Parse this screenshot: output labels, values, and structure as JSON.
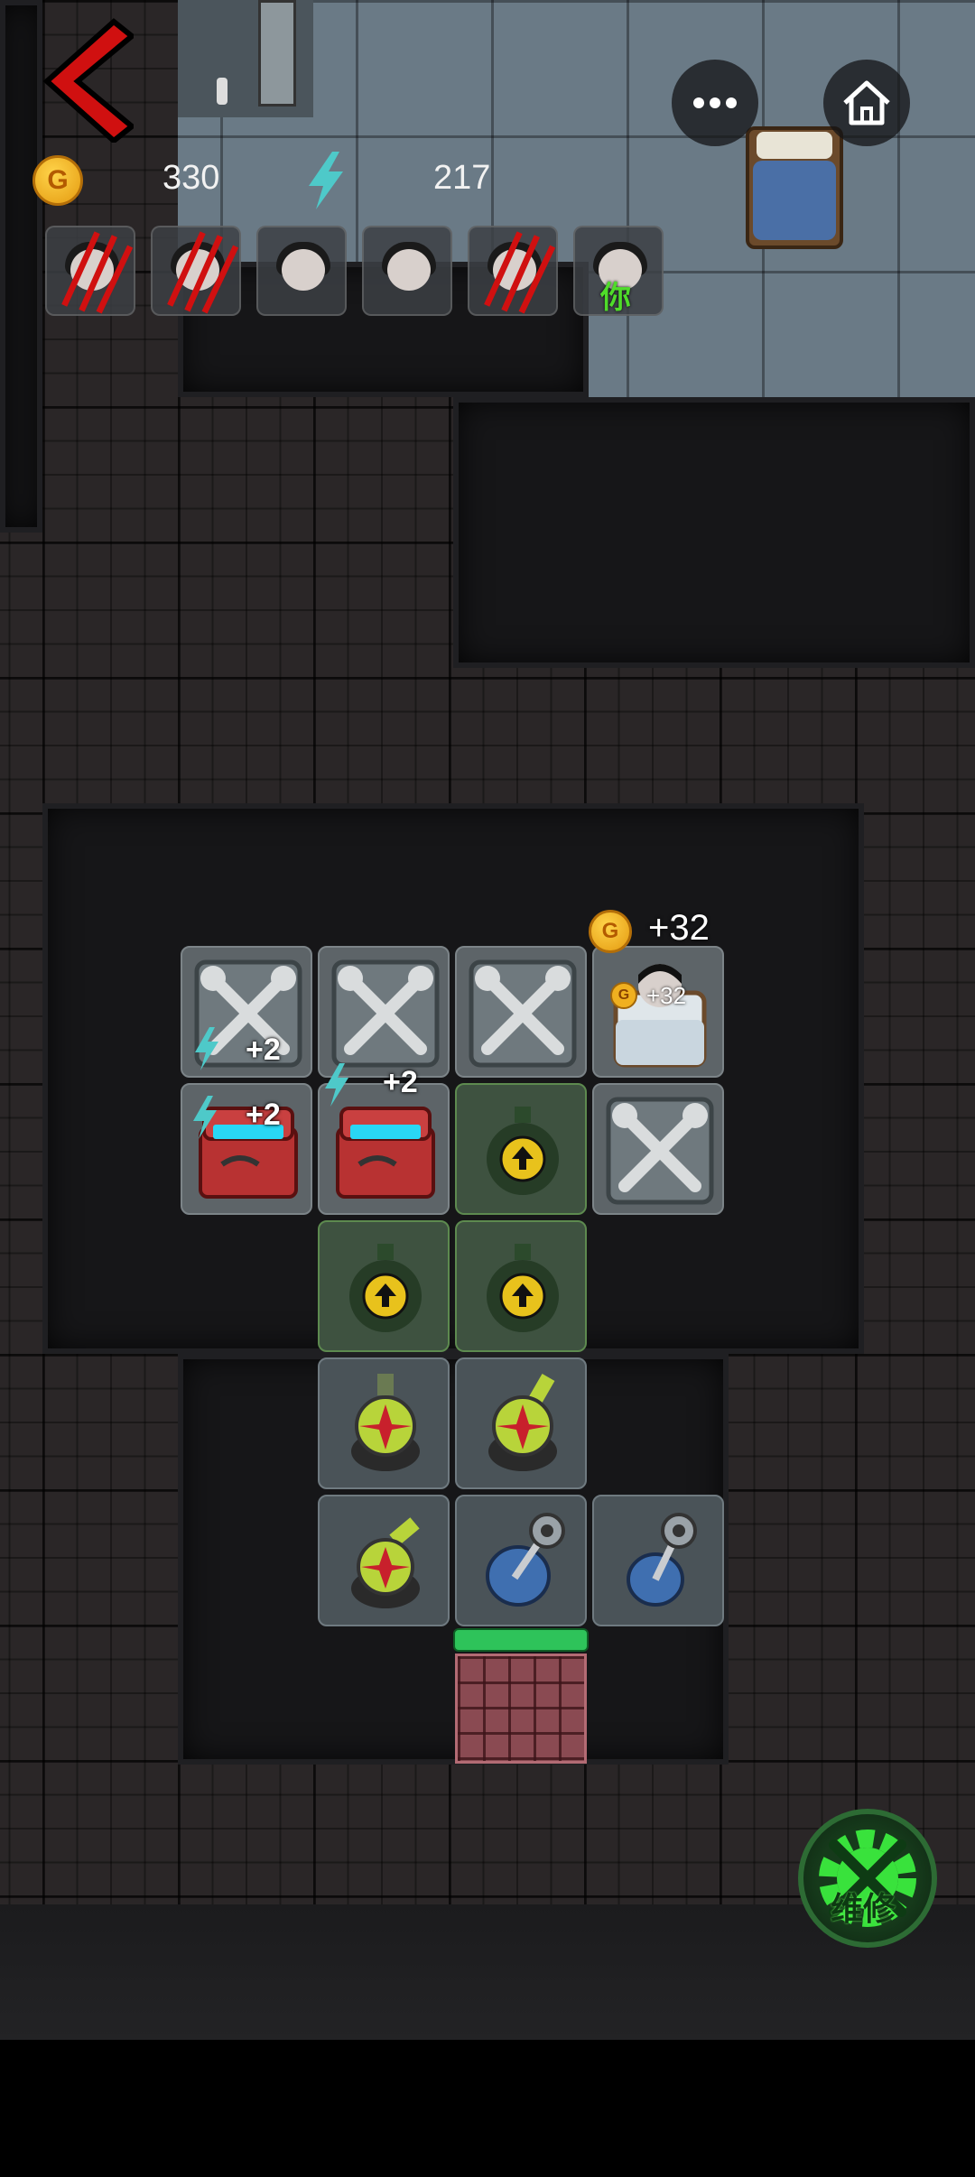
{
  "hud": {
    "gold_value": "330",
    "energy_value": "217",
    "icons": {
      "back": "chevron-left-icon",
      "more": "more-horizontal-icon",
      "home": "home-icon",
      "gold": "coin-icon",
      "energy": "lightning-icon"
    },
    "coin_letter": "G",
    "colors": {
      "back": "#d01010",
      "energy": "#4ec9c9",
      "gold": "#f4b41a"
    }
  },
  "players": [
    {
      "id": "p1",
      "state": "slashed"
    },
    {
      "id": "p2",
      "state": "slashed"
    },
    {
      "id": "p3",
      "state": "normal"
    },
    {
      "id": "p4",
      "state": "normal"
    },
    {
      "id": "p5",
      "state": "slashed"
    },
    {
      "id": "p6",
      "state": "you",
      "label": "你"
    }
  ],
  "board": {
    "gold_popup": "+32",
    "bed_gold": "+32",
    "bonuses": {
      "tool_1": "+2",
      "chest_1": "+2",
      "chest_2": "+2"
    }
  },
  "repair_button": {
    "label": "维修",
    "color": "#39e23c"
  }
}
